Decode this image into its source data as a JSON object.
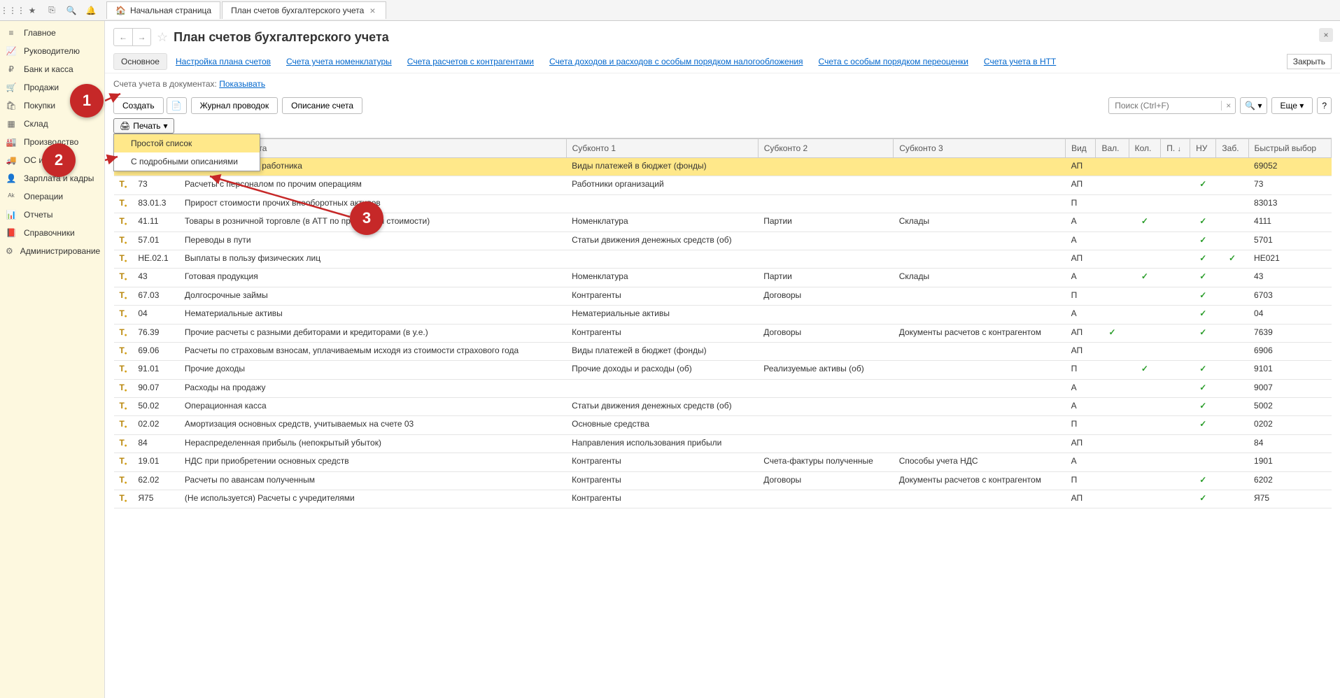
{
  "top_toolbar": {
    "icons": [
      "apps",
      "star",
      "copy",
      "search",
      "bell"
    ]
  },
  "tabs": [
    {
      "icon": "🏠",
      "label": "Начальная страница",
      "closable": false
    },
    {
      "icon": "",
      "label": "План счетов бухгалтерского учета",
      "closable": true,
      "active": true
    }
  ],
  "sidebar": {
    "items": [
      {
        "icon": "≡",
        "label": "Главное"
      },
      {
        "icon": "📈",
        "label": "Руководителю"
      },
      {
        "icon": "₽",
        "label": "Банк и касса"
      },
      {
        "icon": "🛒",
        "label": "Продажи"
      },
      {
        "icon": "🛍",
        "label": "Покупки"
      },
      {
        "icon": "▦",
        "label": "Склад"
      },
      {
        "icon": "🏭",
        "label": "Производство"
      },
      {
        "icon": "🚚",
        "label": "ОС и НМА"
      },
      {
        "icon": "👤",
        "label": "Зарплата и кадры"
      },
      {
        "icon": "ᴬᵏ",
        "label": "Операции"
      },
      {
        "icon": "📊",
        "label": "Отчеты"
      },
      {
        "icon": "📕",
        "label": "Справочники"
      },
      {
        "icon": "⚙",
        "label": "Администрирование"
      }
    ]
  },
  "page": {
    "title": "План счетов бухгалтерского учета",
    "sub_tabs": [
      "Основное",
      "Настройка плана счетов",
      "Счета учета номенклатуры",
      "Счета расчетов с контрагентами",
      "Счета доходов и расходов с особым порядком налогообложения",
      "Счета с особым порядком переоценки",
      "Счета учета в НТТ"
    ],
    "close_label": "Закрыть",
    "info_text_prefix": "Счета учета в документах: ",
    "info_link": "Показывать",
    "toolbar": {
      "create": "Создать",
      "journal": "Журнал проводок",
      "describe": "Описание счета",
      "more": "Еще",
      "search_placeholder": "Поиск (Ctrl+F)"
    },
    "print": {
      "label": "Печать",
      "menu": [
        "Простой список",
        "С подробными описаниями"
      ]
    }
  },
  "table": {
    "columns": [
      "",
      "Код",
      "Наименование счета",
      "Субконто 1",
      "Субконто 2",
      "Субконто 3",
      "Вид",
      "Вал.",
      "Кол.",
      "П.",
      "НУ",
      "Заб.",
      "Быстрый выбор"
    ],
    "rows": [
      {
        "hl": true,
        "code": "",
        "name": "…емые из доходов работника",
        "s1": "Виды платежей в бюджет (фонды)",
        "s2": "",
        "s3": "",
        "vid": "АП",
        "val": "",
        "kol": "",
        "p": "",
        "nu": "",
        "zab": "",
        "fast": "69052"
      },
      {
        "code": "73",
        "name": "Расчеты с персоналом по прочим операциям",
        "s1": "Работники организаций",
        "s2": "",
        "s3": "",
        "vid": "АП",
        "val": "",
        "kol": "",
        "p": "",
        "nu": "✓",
        "zab": "",
        "fast": "73"
      },
      {
        "code": "83.01.3",
        "name": "Прирост стоимости прочих внеоборотных активов",
        "s1": "",
        "s2": "",
        "s3": "",
        "vid": "П",
        "val": "",
        "kol": "",
        "p": "",
        "nu": "",
        "zab": "",
        "fast": "83013"
      },
      {
        "code": "41.11",
        "name": "Товары в розничной торговле (в АТТ по продажной стоимости)",
        "s1": "Номенклатура",
        "s2": "Партии",
        "s3": "Склады",
        "vid": "А",
        "val": "",
        "kol": "✓",
        "p": "",
        "nu": "✓",
        "zab": "",
        "fast": "4111"
      },
      {
        "code": "57.01",
        "name": "Переводы в пути",
        "s1": "Статьи движения денежных средств (об)",
        "s2": "",
        "s3": "",
        "vid": "А",
        "val": "",
        "kol": "",
        "p": "",
        "nu": "✓",
        "zab": "",
        "fast": "5701"
      },
      {
        "code": "НЕ.02.1",
        "name": "Выплаты в пользу физических лиц",
        "s1": "",
        "s2": "",
        "s3": "",
        "vid": "АП",
        "val": "",
        "kol": "",
        "p": "",
        "nu": "✓",
        "zab": "✓",
        "fast": "НЕ021"
      },
      {
        "code": "43",
        "name": "Готовая продукция",
        "s1": "Номенклатура",
        "s2": "Партии",
        "s3": "Склады",
        "vid": "А",
        "val": "",
        "kol": "✓",
        "p": "",
        "nu": "✓",
        "zab": "",
        "fast": "43"
      },
      {
        "code": "67.03",
        "name": "Долгосрочные займы",
        "s1": "Контрагенты",
        "s2": "Договоры",
        "s3": "",
        "vid": "П",
        "val": "",
        "kol": "",
        "p": "",
        "nu": "✓",
        "zab": "",
        "fast": "6703"
      },
      {
        "code": "04",
        "name": "Нематериальные активы",
        "s1": "Нематериальные активы",
        "s2": "",
        "s3": "",
        "vid": "А",
        "val": "",
        "kol": "",
        "p": "",
        "nu": "✓",
        "zab": "",
        "fast": "04"
      },
      {
        "code": "76.39",
        "name": "Прочие расчеты с разными дебиторами и кредиторами (в у.е.)",
        "s1": "Контрагенты",
        "s2": "Договоры",
        "s3": "Документы расчетов с контрагентом",
        "vid": "АП",
        "val": "✓",
        "kol": "",
        "p": "",
        "nu": "✓",
        "zab": "",
        "fast": "7639"
      },
      {
        "code": "69.06",
        "name": "Расчеты по страховым взносам, уплачиваемым исходя из стоимости страхового года",
        "s1": "Виды платежей в бюджет (фонды)",
        "s2": "",
        "s3": "",
        "vid": "АП",
        "val": "",
        "kol": "",
        "p": "",
        "nu": "",
        "zab": "",
        "fast": "6906"
      },
      {
        "code": "91.01",
        "name": "Прочие доходы",
        "s1": "Прочие доходы и расходы (об)",
        "s2": "Реализуемые активы (об)",
        "s3": "",
        "vid": "П",
        "val": "",
        "kol": "✓",
        "p": "",
        "nu": "✓",
        "zab": "",
        "fast": "9101"
      },
      {
        "code": "90.07",
        "name": "Расходы на продажу",
        "s1": "",
        "s2": "",
        "s3": "",
        "vid": "А",
        "val": "",
        "kol": "",
        "p": "",
        "nu": "✓",
        "zab": "",
        "fast": "9007"
      },
      {
        "code": "50.02",
        "name": "Операционная касса",
        "s1": "Статьи движения денежных средств (об)",
        "s2": "",
        "s3": "",
        "vid": "А",
        "val": "",
        "kol": "",
        "p": "",
        "nu": "✓",
        "zab": "",
        "fast": "5002"
      },
      {
        "code": "02.02",
        "name": "Амортизация основных средств, учитываемых на счете 03",
        "s1": "Основные средства",
        "s2": "",
        "s3": "",
        "vid": "П",
        "val": "",
        "kol": "",
        "p": "",
        "nu": "✓",
        "zab": "",
        "fast": "0202"
      },
      {
        "code": "84",
        "name": "Нераспределенная прибыль (непокрытый убыток)",
        "s1": "Направления использования прибыли",
        "s2": "",
        "s3": "",
        "vid": "АП",
        "val": "",
        "kol": "",
        "p": "",
        "nu": "",
        "zab": "",
        "fast": "84"
      },
      {
        "code": "19.01",
        "name": "НДС при приобретении основных средств",
        "s1": "Контрагенты",
        "s2": "Счета-фактуры полученные",
        "s3": "Способы учета НДС",
        "vid": "А",
        "val": "",
        "kol": "",
        "p": "",
        "nu": "",
        "zab": "",
        "fast": "1901"
      },
      {
        "code": "62.02",
        "name": "Расчеты по авансам полученным",
        "s1": "Контрагенты",
        "s2": "Договоры",
        "s3": "Документы расчетов с контрагентом",
        "vid": "П",
        "val": "",
        "kol": "",
        "p": "",
        "nu": "✓",
        "zab": "",
        "fast": "6202"
      },
      {
        "code": "Я75",
        "name": "(Не используется) Расчеты с учредителями",
        "s1": "Контрагенты",
        "s2": "",
        "s3": "",
        "vid": "АП",
        "val": "",
        "kol": "",
        "p": "",
        "nu": "✓",
        "zab": "",
        "fast": "Я75"
      }
    ]
  },
  "callouts": {
    "1": "1",
    "2": "2",
    "3": "3"
  }
}
